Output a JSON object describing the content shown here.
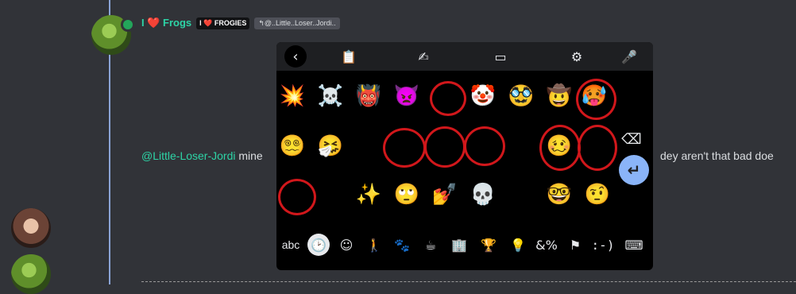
{
  "message": {
    "username": "I ❤️ Frogs",
    "role_tag": "I ❤️ FROGIES",
    "reply_to": "↰@..Little..Loser..Jordi..",
    "mention": "@Little-Loser-Jordi",
    "text": "mine",
    "trailing_text": "dey aren't that bad doe"
  },
  "keyboard": {
    "toolbar": {
      "back": "‹",
      "clipboard": "📋",
      "handwriting": "✍",
      "floating": "▭",
      "settings": "⚙",
      "mic": "🎤"
    },
    "rows": [
      [
        "💥",
        "☠️",
        "👹",
        "👿",
        "😈",
        "🤡",
        "🥸",
        "🤠",
        "🥵"
      ],
      [
        "😵‍💫",
        "🤧",
        "😖",
        "😣",
        "😫",
        "😩",
        "😰",
        "🥴",
        "😋"
      ],
      [
        "😏",
        "😗",
        "✨",
        "🙄",
        "💅",
        "💀",
        "😭",
        "🤓",
        "🤨"
      ]
    ],
    "backspace": "⌫",
    "enter": "↵",
    "categories": {
      "abc": "abc",
      "recent": "🕑",
      "smileys": "☺",
      "people": "🚶",
      "animals": "🐾",
      "food": "☕",
      "travel": "🏢",
      "activities": "🏆",
      "objects": "💡",
      "symbols": "&%",
      "flags": "⚑",
      "emoticons": ":-)",
      "keyboard": "⌨"
    }
  },
  "icons": {
    "accent": "#2dd4a6",
    "circle_color": "#d1171b",
    "enter_color": "#8ab4f8"
  }
}
